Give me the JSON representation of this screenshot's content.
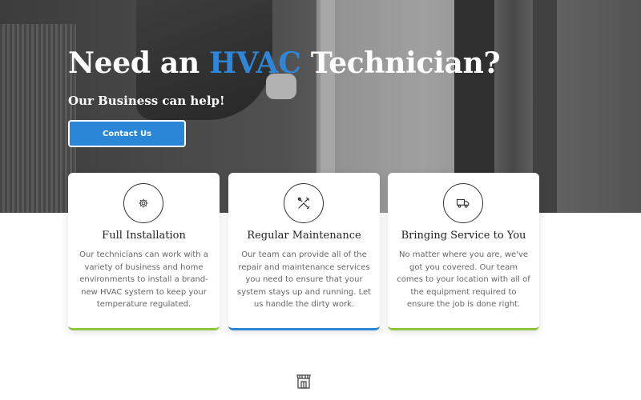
{
  "hero": {
    "title_prefix": "Need an ",
    "title_accent": "HVAC",
    "title_suffix": " Technician?",
    "subtitle": "Our Business can help!",
    "cta_label": "Contact Us"
  },
  "colors": {
    "accent_blue": "#2a86d6",
    "accent_green": "#8cc63f"
  },
  "cards": [
    {
      "icon": "gear-icon",
      "title": "Full Installation",
      "text": "Our technicians can work with a variety of business and home environments to install a brand-new HVAC system to keep your temperature regulated."
    },
    {
      "icon": "tools-icon",
      "title": "Regular Maintenance",
      "text": "Our team can provide all of the repair and maintenance services you need to ensure that your system stays up and running. Let us handle the dirty work."
    },
    {
      "icon": "truck-icon",
      "title": "Bringing Service to You",
      "text": "No matter where you are, we've got you covered. Our team comes to your location with all of the equipment required to ensure the job is done right."
    }
  ],
  "bottom_icon": "storefront-icon"
}
